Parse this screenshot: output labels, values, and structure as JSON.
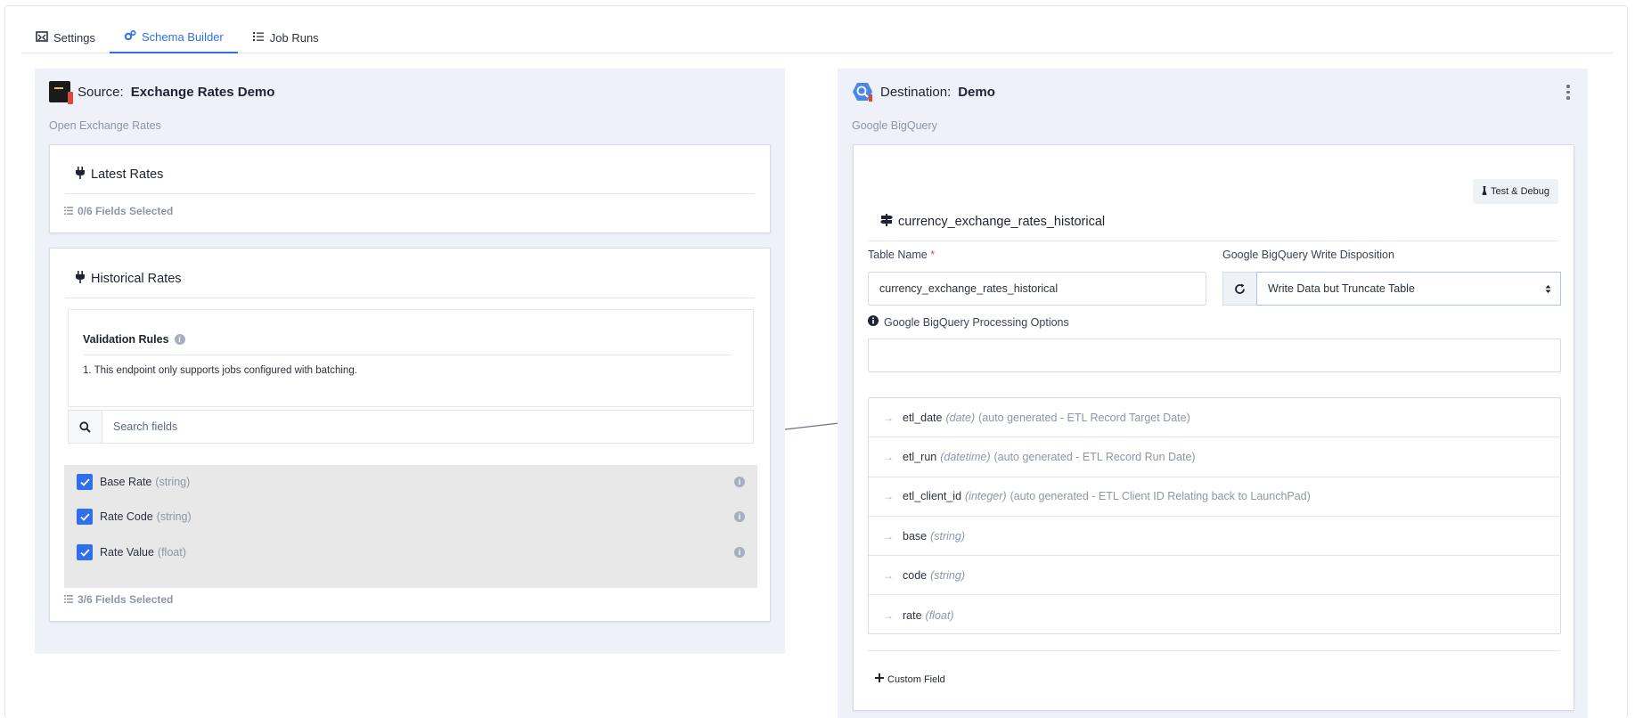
{
  "tabs": [
    {
      "label": "Settings",
      "icon": "settings-icon"
    },
    {
      "label": "Schema Builder",
      "icon": "cogs-icon",
      "active": true
    },
    {
      "label": "Job Runs",
      "icon": "list-icon"
    }
  ],
  "source": {
    "prefix": "Source:",
    "name": "Exchange Rates Demo",
    "subtitle": "Open Exchange Rates",
    "endpoints": [
      {
        "title": "Latest Rates",
        "fields_selected": "0/6 Fields Selected"
      },
      {
        "title": "Historical Rates",
        "validation": {
          "title": "Validation Rules",
          "rule": "1. This endpoint only supports jobs configured with batching."
        },
        "search_placeholder": "Search fields",
        "fields": [
          {
            "name": "Base Rate",
            "type": "(string)",
            "checked": true
          },
          {
            "name": "Rate Code",
            "type": "(string)",
            "checked": true
          },
          {
            "name": "Rate Value",
            "type": "(float)",
            "checked": true
          }
        ],
        "fields_selected": "3/6 Fields Selected"
      }
    ]
  },
  "destination": {
    "prefix": "Destination:",
    "name": "Demo",
    "subtitle": "Google BigQuery",
    "test_debug_label": "Test & Debug",
    "table_title": "currency_exchange_rates_historical",
    "table_name_label": "Table Name",
    "table_name_required": "*",
    "table_name_value": "currency_exchange_rates_historical",
    "write_disposition_label": "Google BigQuery Write Disposition",
    "write_disposition_value": "Write Data but Truncate Table",
    "processing_options_label": "Google BigQuery Processing Options",
    "processing_options_value": "",
    "fields": [
      {
        "name": "etl_date",
        "type": "(date)",
        "note": "(auto generated - ETL Record Target Date)"
      },
      {
        "name": "etl_run",
        "type": "(datetime)",
        "note": "(auto generated - ETL Record Run Date)"
      },
      {
        "name": "etl_client_id",
        "type": "(integer)",
        "note": "(auto generated - ETL Client ID Relating back to LaunchPad)"
      },
      {
        "name": "base",
        "type": "(string)",
        "note": ""
      },
      {
        "name": "code",
        "type": "(string)",
        "note": ""
      },
      {
        "name": "rate",
        "type": "(float)",
        "note": ""
      }
    ],
    "custom_field_label": "Custom Field"
  },
  "colors": {
    "accent": "#2f6fed",
    "panel_bg": "#eef2f8",
    "muted_text": "#8d96a8"
  }
}
